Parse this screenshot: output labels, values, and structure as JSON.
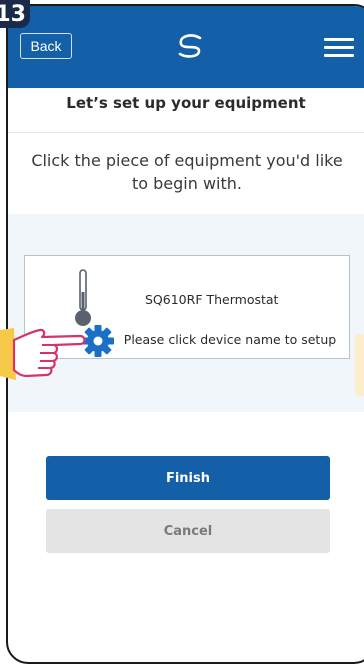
{
  "step_badge": "13",
  "header": {
    "back_label": "Back",
    "logo_icon": "salus-logo-icon",
    "menu_icon": "hamburger-menu-icon"
  },
  "page_title": "Let’s set up your equipment",
  "instruction": "Click the piece of equipment you'd like to begin with.",
  "device_card": {
    "name": "SQ610RF Thermostat",
    "hint": "Please click device name to setup",
    "thermometer_icon": "thermometer-icon",
    "settings_icon": "gear-icon"
  },
  "buttons": {
    "finish_label": "Finish",
    "cancel_label": "Cancel"
  },
  "colors": {
    "primary": "#135fa8",
    "panel_bg": "#f1f6fb",
    "gear": "#1a6fc6",
    "hand_outline": "#d6336c",
    "highlight": "#f7c948"
  }
}
